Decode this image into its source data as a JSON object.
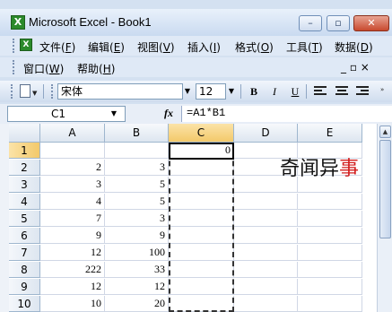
{
  "window": {
    "title": "Microsoft Excel - Book1",
    "app_icon_letter": "X",
    "minimize": "–",
    "restore": "▫",
    "close": "✕"
  },
  "menu": {
    "items": [
      {
        "label": "文件(",
        "acc": "F",
        "end": ")"
      },
      {
        "label": "编辑(",
        "acc": "E",
        "end": ")"
      },
      {
        "label": "视图(",
        "acc": "V",
        "end": ")"
      },
      {
        "label": "插入(",
        "acc": "I",
        "end": ")"
      },
      {
        "label": "格式(",
        "acc": "O",
        "end": ")"
      },
      {
        "label": "工具(",
        "acc": "T",
        "end": ")"
      },
      {
        "label": "数据(",
        "acc": "D",
        "end": ")"
      }
    ],
    "window_item": {
      "label": "窗口(",
      "acc": "W",
      "end": ")"
    },
    "help_item": {
      "label": "帮助(",
      "acc": "H",
      "end": ")"
    },
    "doc_controls": "_ ▫ ×"
  },
  "toolbar": {
    "font_name": "宋体",
    "font_size": "12",
    "bold": "B",
    "italic": "I",
    "underline": "U"
  },
  "formula_bar": {
    "name_box": "C1",
    "fx": "fx",
    "formula": "=A1*B1"
  },
  "sheet": {
    "columns": [
      "A",
      "B",
      "C",
      "D",
      "E"
    ],
    "active_column": "C",
    "active_row": "1",
    "rows": [
      {
        "num": "1",
        "A": "",
        "B": "",
        "C": "0",
        "D": "",
        "E": ""
      },
      {
        "num": "2",
        "A": "2",
        "B": "3",
        "C": "",
        "D": "",
        "E": ""
      },
      {
        "num": "3",
        "A": "3",
        "B": "5",
        "C": "",
        "D": "",
        "E": ""
      },
      {
        "num": "4",
        "A": "4",
        "B": "5",
        "C": "",
        "D": "",
        "E": ""
      },
      {
        "num": "5",
        "A": "7",
        "B": "3",
        "C": "",
        "D": "",
        "E": ""
      },
      {
        "num": "6",
        "A": "9",
        "B": "9",
        "C": "",
        "D": "",
        "E": ""
      },
      {
        "num": "7",
        "A": "12",
        "B": "100",
        "C": "",
        "D": "",
        "E": ""
      },
      {
        "num": "8",
        "A": "222",
        "B": "33",
        "C": "",
        "D": "",
        "E": ""
      },
      {
        "num": "9",
        "A": "12",
        "B": "12",
        "C": "",
        "D": "",
        "E": ""
      },
      {
        "num": "10",
        "A": "10",
        "B": "20",
        "C": "",
        "D": "",
        "E": ""
      }
    ]
  },
  "watermark": {
    "black": "奇闻异",
    "red": "事"
  },
  "colors": {
    "accent": "#f3c96a",
    "titlebar": "#c9daf0",
    "watermark_red": "#d21d1d"
  }
}
